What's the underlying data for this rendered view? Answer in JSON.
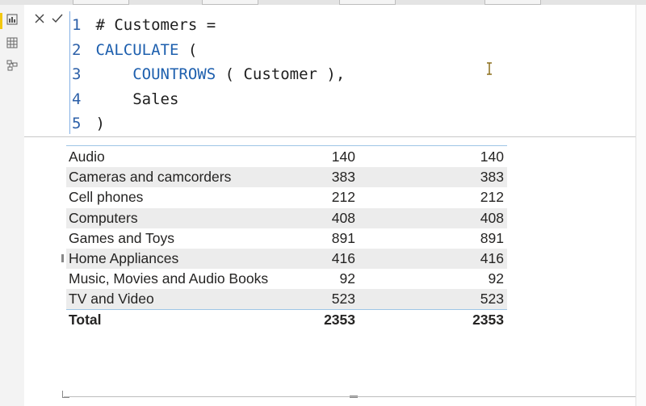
{
  "rail": {
    "items": [
      "report-view",
      "data-view",
      "model-view"
    ]
  },
  "editor": {
    "commit_icons": [
      "close-icon",
      "check-icon"
    ],
    "lines": [
      {
        "num": "1",
        "tokens": [
          {
            "text": " # Customers =",
            "kind": "plain"
          }
        ]
      },
      {
        "num": "2",
        "tokens": [
          {
            "text": " CALCULATE",
            "kind": "kw"
          },
          {
            "text": " (",
            "kind": "plain"
          }
        ]
      },
      {
        "num": "3",
        "tokens": [
          {
            "text": "     ",
            "kind": "plain"
          },
          {
            "text": "COUNTROWS",
            "kind": "kw"
          },
          {
            "text": " ( Customer ),",
            "kind": "plain"
          }
        ]
      },
      {
        "num": "4",
        "tokens": [
          {
            "text": "     Sales",
            "kind": "plain"
          }
        ]
      },
      {
        "num": "5",
        "tokens": [
          {
            "text": " )",
            "kind": "plain"
          }
        ]
      }
    ]
  },
  "table": {
    "rows": [
      {
        "category": "Audio",
        "v1": "140",
        "v2": "140"
      },
      {
        "category": "Cameras and camcorders",
        "v1": "383",
        "v2": "383"
      },
      {
        "category": "Cell phones",
        "v1": "212",
        "v2": "212"
      },
      {
        "category": "Computers",
        "v1": "408",
        "v2": "408"
      },
      {
        "category": "Games and Toys",
        "v1": "891",
        "v2": "891"
      },
      {
        "category": "Home Appliances",
        "v1": "416",
        "v2": "416"
      },
      {
        "category": "Music, Movies and Audio Books",
        "v1": "92",
        "v2": "92"
      },
      {
        "category": "TV and Video",
        "v1": "523",
        "v2": "523"
      }
    ],
    "total": {
      "category": "Total",
      "v1": "2353",
      "v2": "2353"
    }
  },
  "colors": {
    "keyword": "#1d5fae",
    "line_number": "#2b5fa8",
    "accent_active": "#f2c811",
    "row_band": "#ececec"
  }
}
